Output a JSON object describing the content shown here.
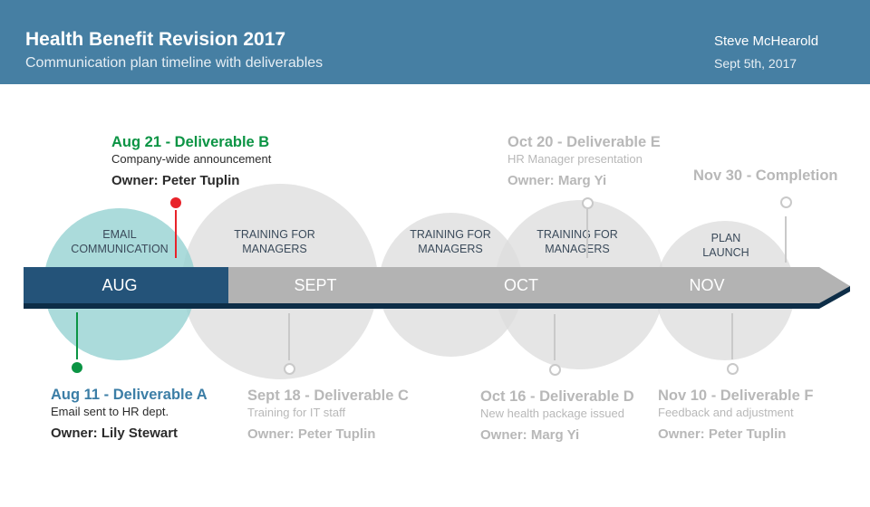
{
  "header": {
    "title": "Health Benefit Revision 2017",
    "subtitle": "Communication plan timeline with deliverables",
    "author": "Steve McHearold",
    "date": "Sept 5th, 2017"
  },
  "colors": {
    "header": "#467fa3",
    "aug_bar": "#245379",
    "bar": "#b3b3b3",
    "bar_shadow": "#0d2d47",
    "teal": "#a7d9d9",
    "gray_circle": "#e3e3e3",
    "green": "#0b9444",
    "red": "#e8232a",
    "blue_text": "#3c7ea6"
  },
  "phases": [
    {
      "label_1": "EMAIL",
      "label_2": "COMMUNICATION"
    },
    {
      "label_1": "TRAINING FOR",
      "label_2": "MANAGERS"
    },
    {
      "label_1": "TRAINING FOR",
      "label_2": "MANAGERS"
    },
    {
      "label_1": "TRAINING FOR",
      "label_2": "MANAGERS"
    },
    {
      "label_1": "PLAN",
      "label_2": "LAUNCH"
    }
  ],
  "months": [
    "AUG",
    "SEPT",
    "OCT",
    "NOV"
  ],
  "events": [
    {
      "heading": "Aug 11 - Deliverable A",
      "desc": "Email sent to HR dept.",
      "owner": "Owner: Lily Stewart"
    },
    {
      "heading": "Aug 21 - Deliverable B",
      "desc": "Company-wide announcement",
      "owner": "Owner: Peter Tuplin"
    },
    {
      "heading": "Sept 18 - Deliverable C",
      "desc": "Training for IT staff",
      "owner": "Owner: Peter Tuplin"
    },
    {
      "heading": "Oct 16 - Deliverable D",
      "desc": "New health package issued",
      "owner": "Owner: Marg Yi"
    },
    {
      "heading": "Oct 20 - Deliverable E",
      "desc": "HR Manager presentation",
      "owner": "Owner: Marg Yi"
    },
    {
      "heading": "Nov 10 - Deliverable F",
      "desc": "Feedback and adjustment",
      "owner": "Owner: Peter Tuplin"
    },
    {
      "heading": "Nov 30 - Completion"
    }
  ]
}
